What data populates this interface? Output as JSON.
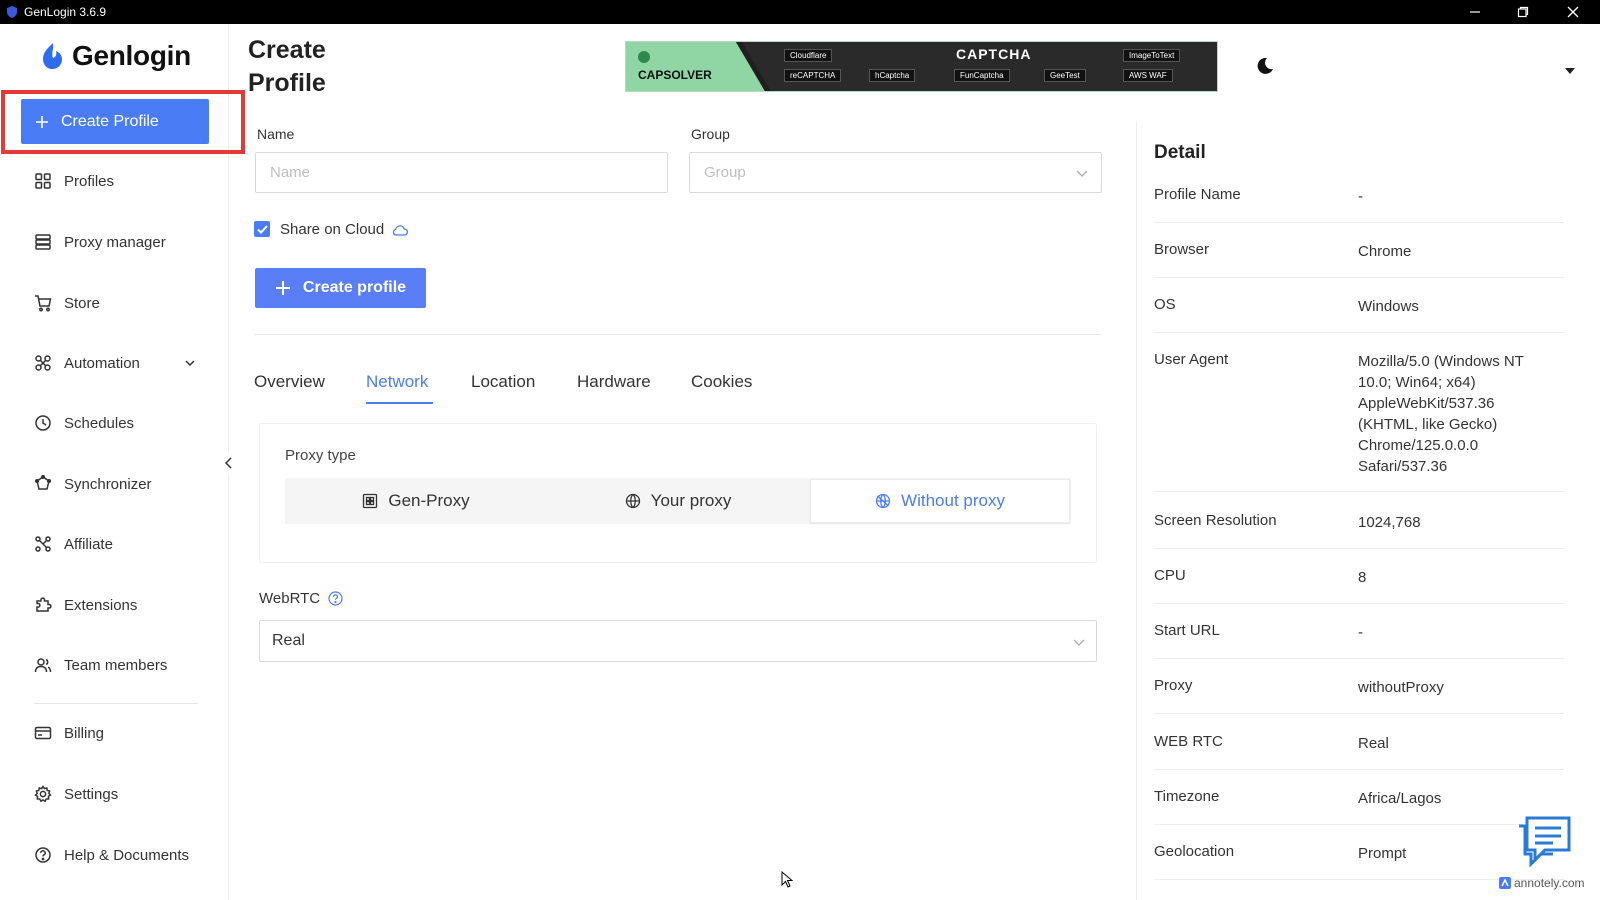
{
  "window": {
    "title": "GenLogin 3.6.9",
    "controls": [
      "minimize",
      "restore",
      "close"
    ]
  },
  "sidebar": {
    "brand": "Genlogin",
    "create_button": "Create Profile",
    "items": [
      {
        "label": "Profiles",
        "icon": "grid-icon"
      },
      {
        "label": "Proxy manager",
        "icon": "server-icon"
      },
      {
        "label": "Store",
        "icon": "cart-icon"
      },
      {
        "label": "Automation",
        "icon": "automation-icon"
      },
      {
        "label": "Schedules",
        "icon": "clock-icon"
      },
      {
        "label": "Synchronizer",
        "icon": "sync-icon"
      },
      {
        "label": "Affiliate",
        "icon": "affiliate-icon"
      },
      {
        "label": "Extensions",
        "icon": "puzzle-icon"
      },
      {
        "label": "Team members",
        "icon": "team-icon"
      },
      {
        "label": "Billing",
        "icon": "card-icon"
      },
      {
        "label": "Settings",
        "icon": "gear-icon"
      },
      {
        "label": "Help & Documents",
        "icon": "help-icon"
      }
    ]
  },
  "header": {
    "title_line1": "Create",
    "title_line2": "Profile",
    "banner": {
      "brand": "CAPSOLVER",
      "headline": "CAPTCHA",
      "tags": [
        "Cloudflare",
        "reCAPTCHA",
        "hCaptcha",
        "FunCaptcha",
        "GeeTest",
        "ImageToText",
        "AWS WAF"
      ]
    }
  },
  "form": {
    "name_label": "Name",
    "name_placeholder": "Name",
    "group_label": "Group",
    "group_placeholder": "Group",
    "share_label": "Share on Cloud",
    "share_checked": true,
    "create_button": "Create profile"
  },
  "tabs": {
    "items": [
      "Overview",
      "Network",
      "Location",
      "Hardware",
      "Cookies"
    ],
    "active": "Network"
  },
  "network": {
    "proxy_type_label": "Proxy type",
    "options": [
      "Gen-Proxy",
      "Your proxy",
      "Without proxy"
    ],
    "selected": "Without proxy",
    "webrtc_label": "WebRTC",
    "webrtc_value": "Real"
  },
  "detail": {
    "title": "Detail",
    "rows": [
      {
        "key": "Profile Name",
        "value": "-"
      },
      {
        "key": "Browser",
        "value": "Chrome"
      },
      {
        "key": "OS",
        "value": "Windows"
      },
      {
        "key": "User Agent",
        "value": "Mozilla/5.0 (Windows NT 10.0; Win64; x64) AppleWebKit/537.36 (KHTML, like Gecko) Chrome/125.0.0.0 Safari/537.36"
      },
      {
        "key": "Screen Resolution",
        "value": "1024,768"
      },
      {
        "key": "CPU",
        "value": "8"
      },
      {
        "key": "Start URL",
        "value": "-"
      },
      {
        "key": "Proxy",
        "value": "withoutProxy"
      },
      {
        "key": "WEB RTC",
        "value": "Real"
      },
      {
        "key": "Timezone",
        "value": "Africa/Lagos"
      },
      {
        "key": "Geolocation",
        "value": "Prompt"
      }
    ]
  },
  "watermark": "annotely.com",
  "colors": {
    "accent": "#4a7cf6",
    "highlight": "#e53935",
    "titlebar": "#000000"
  }
}
